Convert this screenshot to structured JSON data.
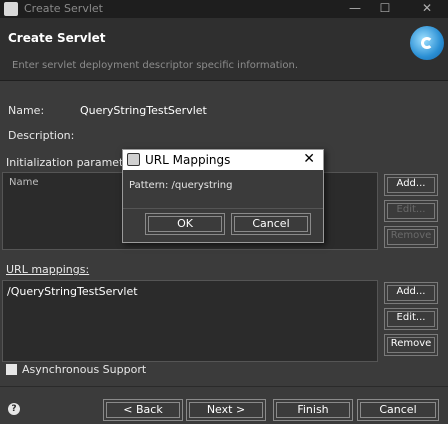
{
  "window": {
    "title": "Create Servlet",
    "minimize": "—",
    "maximize": "☐",
    "close": "✕"
  },
  "header": {
    "title": "Create Servlet",
    "description": "Enter servlet deployment descriptor specific information."
  },
  "form": {
    "name_label": "Name:",
    "name_value": "QueryStringTestServlet",
    "description_label": "Description:",
    "init_params_label": "Initialization paramete",
    "init_params_col": "Name",
    "url_mappings_label": "URL mappings:",
    "url_mappings_rows": [
      "/QueryStringTestServlet"
    ],
    "async_label": "Asynchronous Support"
  },
  "init_buttons": {
    "add": "Add...",
    "edit": "Edit...",
    "remove": "Remove"
  },
  "url_buttons": {
    "add": "Add...",
    "edit": "Edit...",
    "remove": "Remove"
  },
  "footer": {
    "help": "?",
    "back": "< Back",
    "next": "Next >",
    "finish": "Finish",
    "cancel": "Cancel"
  },
  "modal": {
    "title": "URL Mappings",
    "close": "✕",
    "pattern": "Pattern: /querystring",
    "ok": "OK",
    "cancel": "Cancel"
  }
}
